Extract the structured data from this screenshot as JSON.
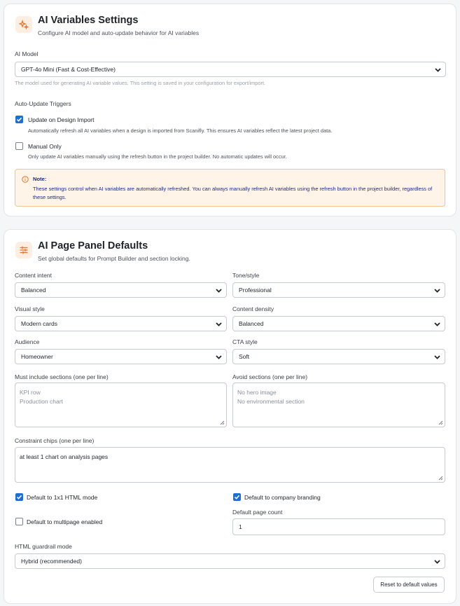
{
  "ai_settings": {
    "title": "AI Variables Settings",
    "subtitle": "Configure AI model and auto-update behavior for AI variables",
    "icon": "sparkle-icon",
    "model_label": "AI Model",
    "model_value": "GPT-4o Mini (Fast & Cost-Effective)",
    "model_hint": "The model used for generating AI variable values. This setting is saved in your configuration for export/import.",
    "triggers_heading": "Auto-Update Triggers",
    "triggers": [
      {
        "label": "Update on Design Import",
        "description": "Automatically refresh all AI variables when a design is imported from Scanifly. This ensures AI variables reflect the latest project data.",
        "checked": true
      },
      {
        "label": "Manual Only",
        "description": "Only update AI variables manually using the refresh button in the project builder. No automatic updates will occur.",
        "checked": false
      }
    ],
    "note": {
      "title": "Note:",
      "text": "These settings control when AI variables are automatically refreshed. You can always manually refresh AI variables using the refresh button in the project builder, regardless of these settings.",
      "icon": "info-icon"
    }
  },
  "page_panel": {
    "title": "AI Page Panel Defaults",
    "subtitle": "Set global defaults for Prompt Builder and section locking.",
    "icon": "sliders-icon",
    "fields": {
      "content_intent": {
        "label": "Content intent",
        "value": "Balanced"
      },
      "tone_style": {
        "label": "Tone/style",
        "value": "Professional"
      },
      "visual_style": {
        "label": "Visual style",
        "value": "Modern cards"
      },
      "content_density": {
        "label": "Content density",
        "value": "Balanced"
      },
      "audience": {
        "label": "Audience",
        "value": "Homeowner"
      },
      "cta_style": {
        "label": "CTA style",
        "value": "Soft"
      }
    },
    "must_include": {
      "label": "Must include sections (one per line)",
      "placeholder": "KPI row\nProduction chart"
    },
    "avoid": {
      "label": "Avoid sections (one per line)",
      "placeholder": "No hero image\nNo environmental section"
    },
    "constraint_chips": {
      "label": "Constraint chips (one per line)",
      "value": "at least 1 chart on analysis pages"
    },
    "checkboxes": {
      "html_mode": {
        "label": "Default to 1x1 HTML mode",
        "checked": true
      },
      "company_branding": {
        "label": "Default to company branding",
        "checked": true
      },
      "multipage": {
        "label": "Default to multipage enabled",
        "checked": false
      }
    },
    "page_count": {
      "label": "Default page count",
      "value": "1"
    },
    "guardrail": {
      "label": "HTML guardrail mode",
      "value": "Hybrid (recommended)"
    },
    "reset_label": "Reset to default values"
  },
  "colors": {
    "accent": "#1f6fd1",
    "icon_accent": "#e8742c",
    "note_background": "#fff4e7",
    "note_border": "#f3c491",
    "note_text": "#1a2a8c"
  }
}
